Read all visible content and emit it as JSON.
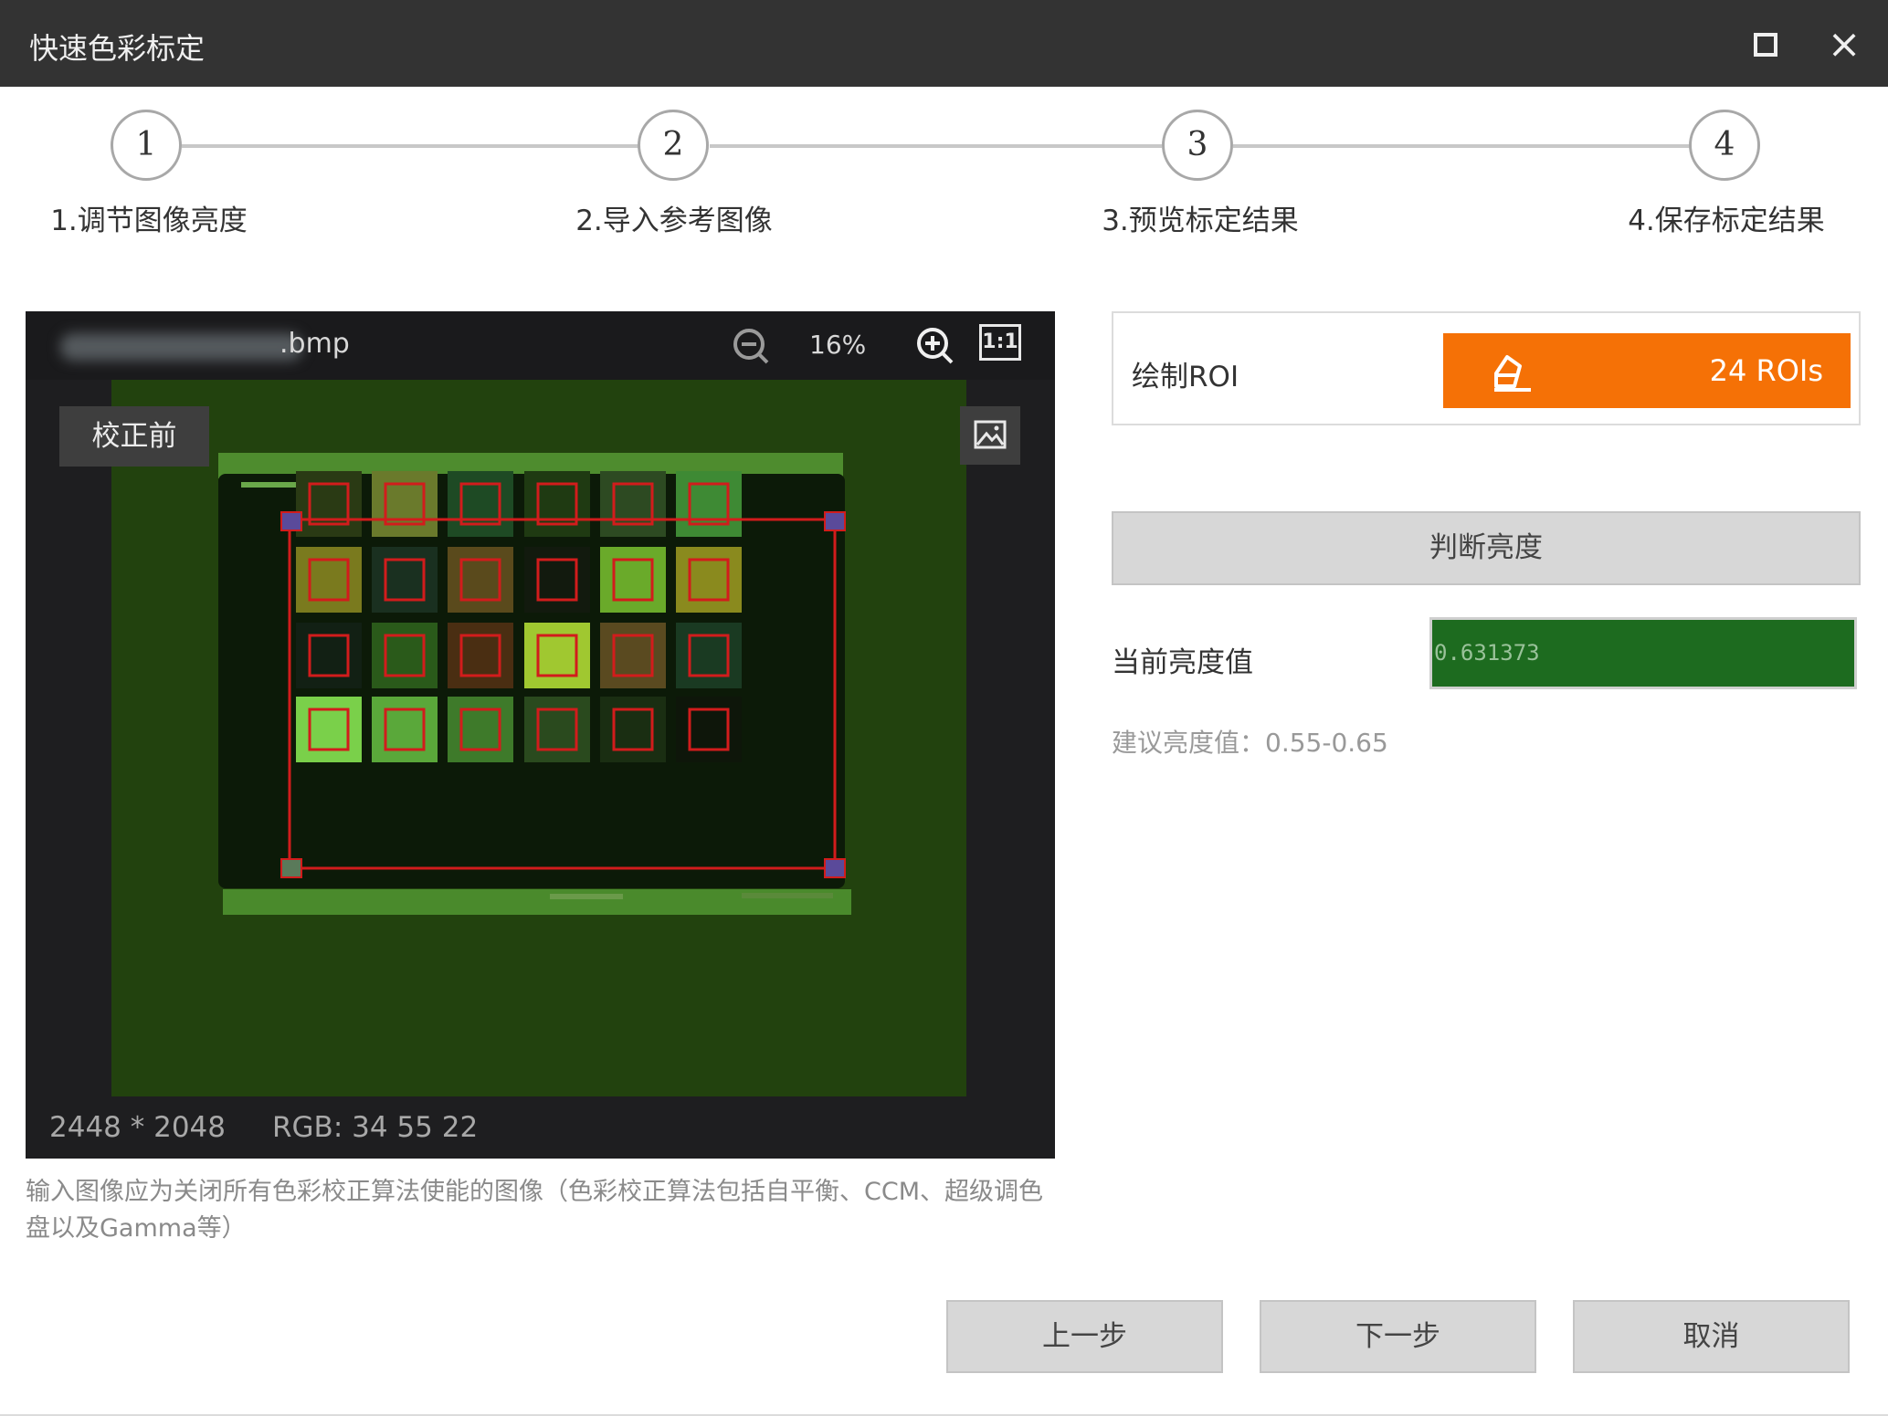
{
  "window": {
    "title": "快速色彩标定",
    "maximize_icon": "square-icon",
    "close_icon": "×"
  },
  "steps": [
    {
      "number": "1",
      "label": "1.调节图像亮度"
    },
    {
      "number": "2",
      "label": "2.导入参考图像"
    },
    {
      "number": "3",
      "label": "3.预览标定结果"
    },
    {
      "number": "4",
      "label": "4.保存标定结果"
    }
  ],
  "viewer": {
    "filename_suffix": ".bmp",
    "zoom_level": "16%",
    "one_to_one_label": "1:1",
    "before_badge": "校正前",
    "resolution": "2448 * 2048",
    "rgb": "RGB: 34 55 22"
  },
  "hint": "输入图像应为关闭所有色彩校正算法使能的图像（色彩校正算法包括自平衡、CCM、超级调色盘以及Gamma等）",
  "roi": {
    "label": "绘制ROI",
    "count_text": "24 ROIs",
    "accent": "#f57106"
  },
  "brightness": {
    "judge_button": "判断亮度",
    "current_label": "当前亮度值",
    "current_value": "0.631373",
    "suggest": "建议亮度值：0.55-0.65",
    "field_color": "#1d6b1f"
  },
  "footer": {
    "prev": "上一步",
    "next": "下一步",
    "cancel": "取消"
  }
}
